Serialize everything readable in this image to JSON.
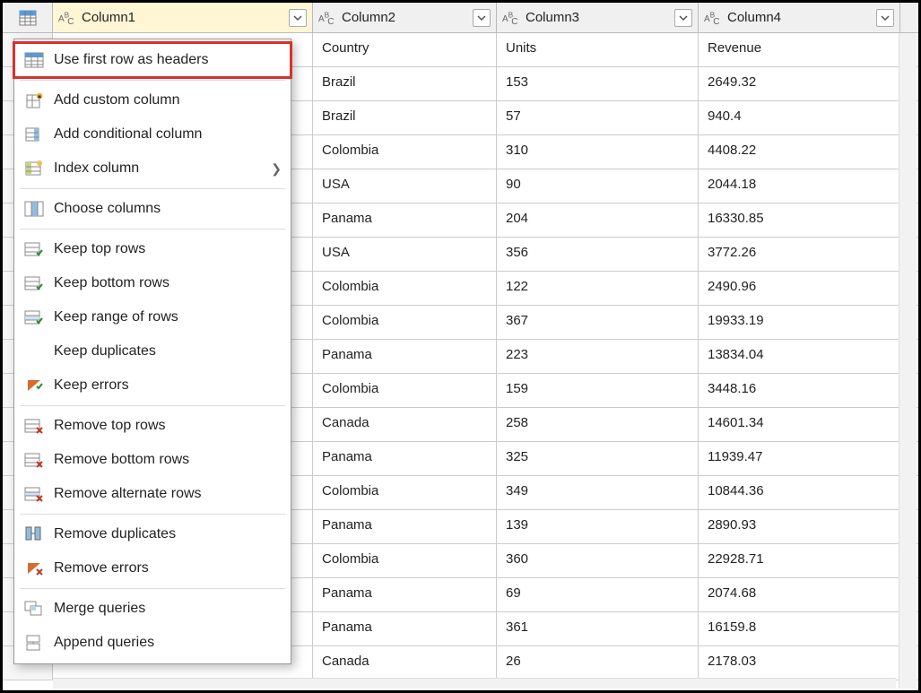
{
  "columns": [
    {
      "name": "Column1",
      "selected": true
    },
    {
      "name": "Column2",
      "selected": false
    },
    {
      "name": "Column3",
      "selected": false
    },
    {
      "name": "Column4",
      "selected": false
    }
  ],
  "rows": [
    [
      "Country",
      "Units",
      "Revenue"
    ],
    [
      "Brazil",
      "153",
      "2649.32"
    ],
    [
      "Brazil",
      "57",
      "940.4"
    ],
    [
      "Colombia",
      "310",
      "4408.22"
    ],
    [
      "USA",
      "90",
      "2044.18"
    ],
    [
      "Panama",
      "204",
      "16330.85"
    ],
    [
      "USA",
      "356",
      "3772.26"
    ],
    [
      "Colombia",
      "122",
      "2490.96"
    ],
    [
      "Colombia",
      "367",
      "19933.19"
    ],
    [
      "Panama",
      "223",
      "13834.04"
    ],
    [
      "Colombia",
      "159",
      "3448.16"
    ],
    [
      "Canada",
      "258",
      "14601.34"
    ],
    [
      "Panama",
      "325",
      "11939.47"
    ],
    [
      "Colombia",
      "349",
      "10844.36"
    ],
    [
      "Panama",
      "139",
      "2890.93"
    ],
    [
      "Colombia",
      "360",
      "22928.71"
    ],
    [
      "Panama",
      "69",
      "2074.68"
    ],
    [
      "Panama",
      "361",
      "16159.8"
    ],
    [
      "Canada",
      "26",
      "2178.03"
    ]
  ],
  "menu": {
    "use_first_row": "Use first row as headers",
    "add_custom_column": "Add custom column",
    "add_conditional_column": "Add conditional column",
    "index_column": "Index column",
    "choose_columns": "Choose columns",
    "keep_top_rows": "Keep top rows",
    "keep_bottom_rows": "Keep bottom rows",
    "keep_range_rows": "Keep range of rows",
    "keep_duplicates": "Keep duplicates",
    "keep_errors": "Keep errors",
    "remove_top_rows": "Remove top rows",
    "remove_bottom_rows": "Remove bottom rows",
    "remove_alternate_rows": "Remove alternate rows",
    "remove_duplicates": "Remove duplicates",
    "remove_errors": "Remove errors",
    "merge_queries": "Merge queries",
    "append_queries": "Append queries"
  }
}
